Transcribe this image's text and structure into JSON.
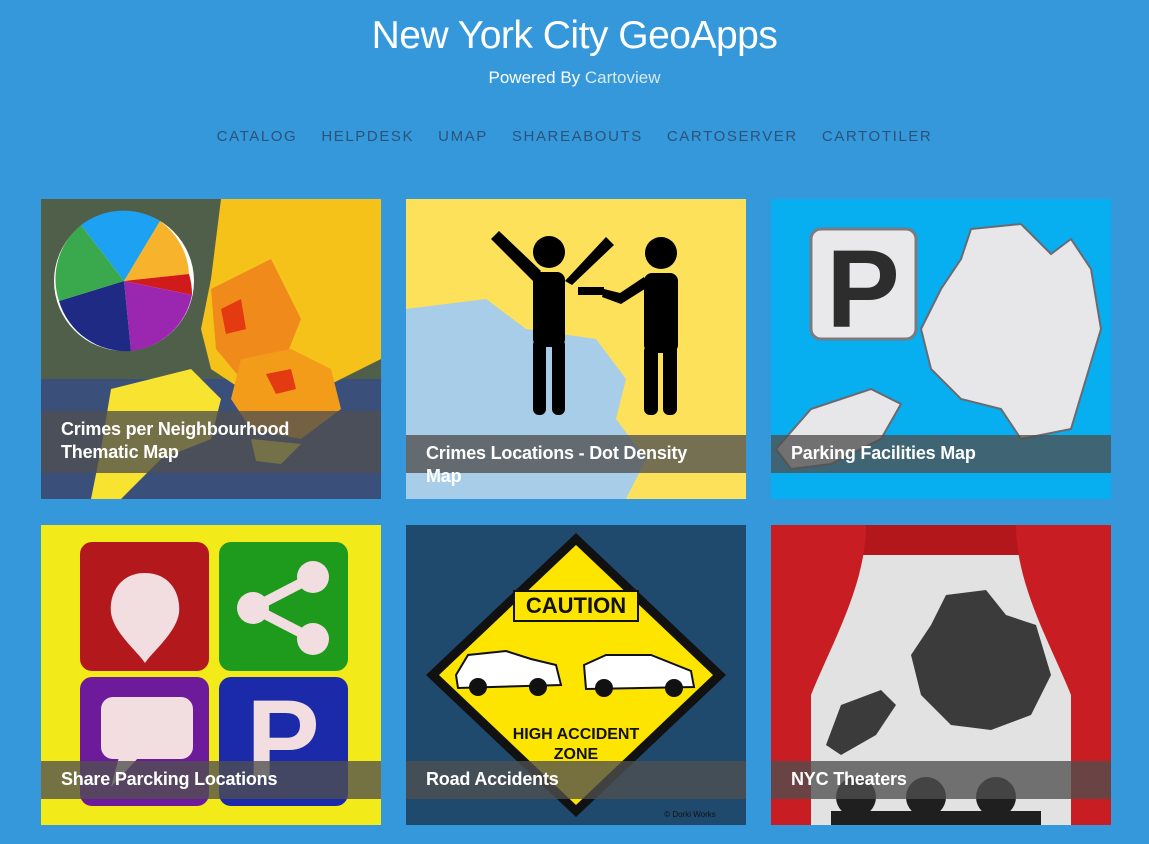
{
  "header": {
    "title": "New York City GeoApps",
    "powered_prefix": "Powered By",
    "powered_link": "Cartoview"
  },
  "nav": {
    "items": [
      "CATALOG",
      "HELPDESK",
      "UMAP",
      "SHAREABOUTS",
      "CARTOSERVER",
      "CARTOTILER"
    ]
  },
  "cards": [
    {
      "title": "Crimes per Neighbourhood Thematic Map",
      "line1": "Crimes per Neighbourhood",
      "line2": "Thematic Map"
    },
    {
      "title": "Crimes Locations - Dot Density Map"
    },
    {
      "title": "Parking Facilities Map",
      "sign_letter": "P"
    },
    {
      "title": "Share Parcking Locations",
      "sign_letter": "P"
    },
    {
      "title": "Road Accidents",
      "sign_top": "CAUTION",
      "sign_line1": "HIGH ACCIDENT",
      "sign_line2": "ZONE",
      "credit": "© Dorki Works"
    },
    {
      "title": "NYC Theaters"
    }
  ],
  "colors": {
    "page_bg": "#3498db",
    "nav_text": "#2c5378",
    "caption_bg": "rgba(80,80,80,0.78)"
  }
}
